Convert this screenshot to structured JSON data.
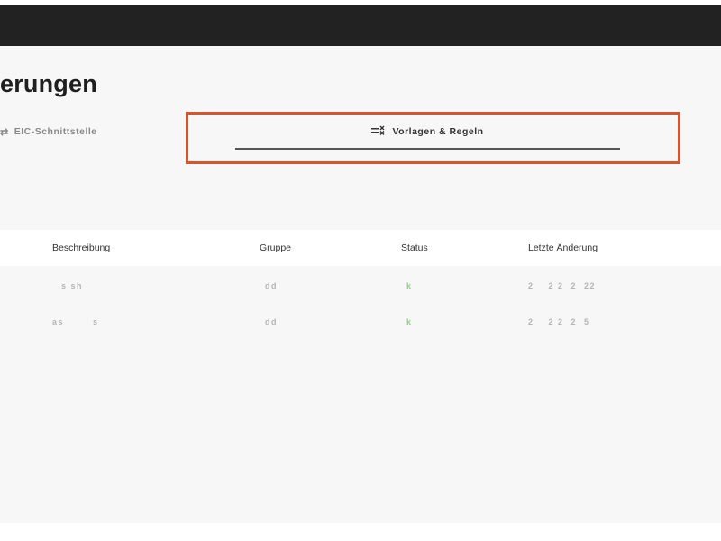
{
  "page": {
    "title": "erungen"
  },
  "tabs": [
    {
      "label": "EIC-Schnittstelle",
      "icon": "swap-arrows-icon",
      "active": false
    },
    {
      "label": "Vorlagen & Regeln",
      "icon": "playlist-remove-icon",
      "active": true
    }
  ],
  "table": {
    "columns": [
      "Beschreibung",
      "Gruppe",
      "Status",
      "Letzte Änderung"
    ],
    "rows": [
      {
        "beschreibung": "s sh",
        "gruppe": "dd",
        "status": "k",
        "letzte_aenderung": "2    2 2  2  22"
      },
      {
        "beschreibung": "as        s",
        "gruppe": "dd",
        "status": "k",
        "letzte_aenderung": "2    2 2  2  5"
      }
    ]
  },
  "colors": {
    "topbar": "#222222",
    "highlight": "#d9532c",
    "status_ok": "#8ccf8c"
  }
}
